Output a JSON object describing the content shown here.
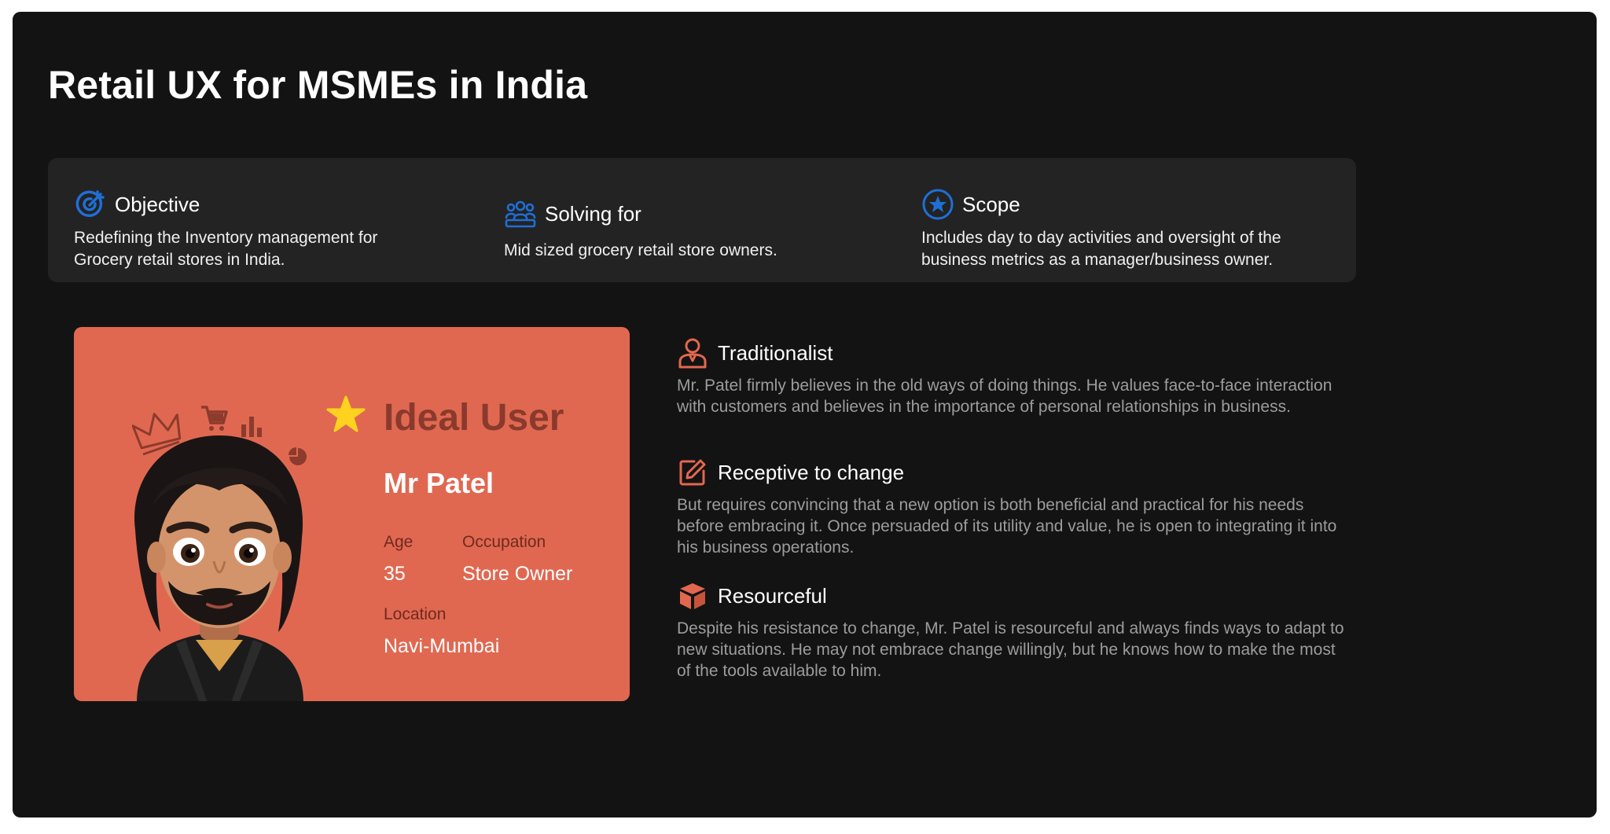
{
  "page": {
    "title": "Retail UX for MSMEs in India"
  },
  "info": {
    "objective": {
      "icon": "target-icon",
      "title": "Objective",
      "text": "Redefining the Inventory management for Grocery retail stores in India."
    },
    "solving": {
      "icon": "users-group-icon",
      "title": "Solving for",
      "text": "Mid sized grocery retail store owners."
    },
    "scope": {
      "icon": "star-circle-icon",
      "title": "Scope",
      "text": "Includes day to day activities and oversight of the business metrics as a manager/business owner."
    }
  },
  "persona": {
    "label": "Ideal User",
    "name": "Mr Patel",
    "age_label": "Age",
    "age": "35",
    "occupation_label": "Occupation",
    "occupation": "Store Owner",
    "location_label": "Location",
    "location": "Navi-Mumbai",
    "card_color": "#e06851"
  },
  "traits": [
    {
      "icon": "person-icon",
      "title": "Traditionalist",
      "text": "Mr. Patel firmly believes in the old ways of doing things. He values face-to-face interaction with customers and believes in the importance of personal relationships in business."
    },
    {
      "icon": "edit-icon",
      "title": "Receptive to change",
      "text": "But requires convincing that a new option is both beneficial and practical for his needs before embracing it. Once persuaded of its utility and value, he is open to integrating it into his business operations."
    },
    {
      "icon": "box-icon",
      "title": "Resourceful",
      "text": " Despite his resistance to change, Mr. Patel is resourceful and always finds ways to adapt to new situations. He may not embrace change willingly, but he knows how to make the most of the tools available to him."
    }
  ],
  "colors": {
    "accent_blue": "#1f6fd6",
    "accent_orange": "#e2674f",
    "background": "#141313",
    "panel": "#232323"
  }
}
